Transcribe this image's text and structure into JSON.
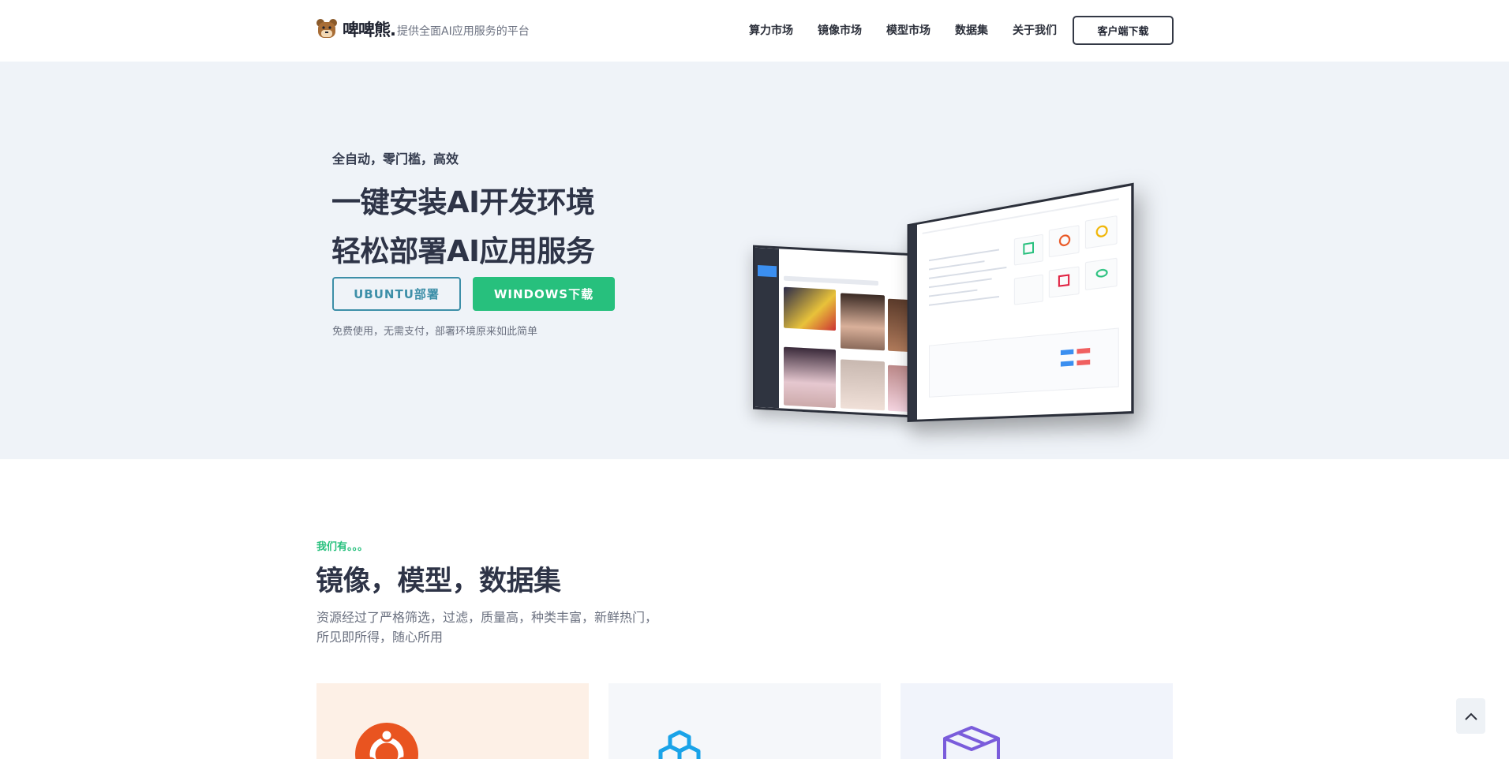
{
  "header": {
    "brand": "啤啤熊.",
    "tagline": "提供全面AI应用服务的平台",
    "nav": [
      "算力市场",
      "镜像市场",
      "模型市场",
      "数据集",
      "关于我们"
    ],
    "download_label": "客户端下载"
  },
  "hero": {
    "subtitle": "全自动，零门槛，高效",
    "title_line1": "一键安装AI开发环境",
    "title_line2": "轻松部署AI应用服务",
    "btn_ubuntu": "UBUNTU部署",
    "btn_windows": "WINDOWS下载",
    "note": "免费使用，无需支付，部署环境原来如此简单"
  },
  "section": {
    "kicker": "我们有。。。",
    "title": "镜像，模型，数据集",
    "desc_line1": "资源经过了严格筛选，过滤，质量高，种类丰富，新鲜热门，",
    "desc_line2": "所见即所得，随心所用"
  },
  "cards": [
    {
      "icon": "ubuntu-icon",
      "color": "#e95420"
    },
    {
      "icon": "cubes-icon",
      "color": "#1aa3e8"
    },
    {
      "icon": "box-icon",
      "color": "#7a5cdb"
    }
  ],
  "colors": {
    "accent_green": "#27c07d",
    "ubuntu_teal": "#3d8fa8",
    "hero_bg": "#eff3f8"
  }
}
